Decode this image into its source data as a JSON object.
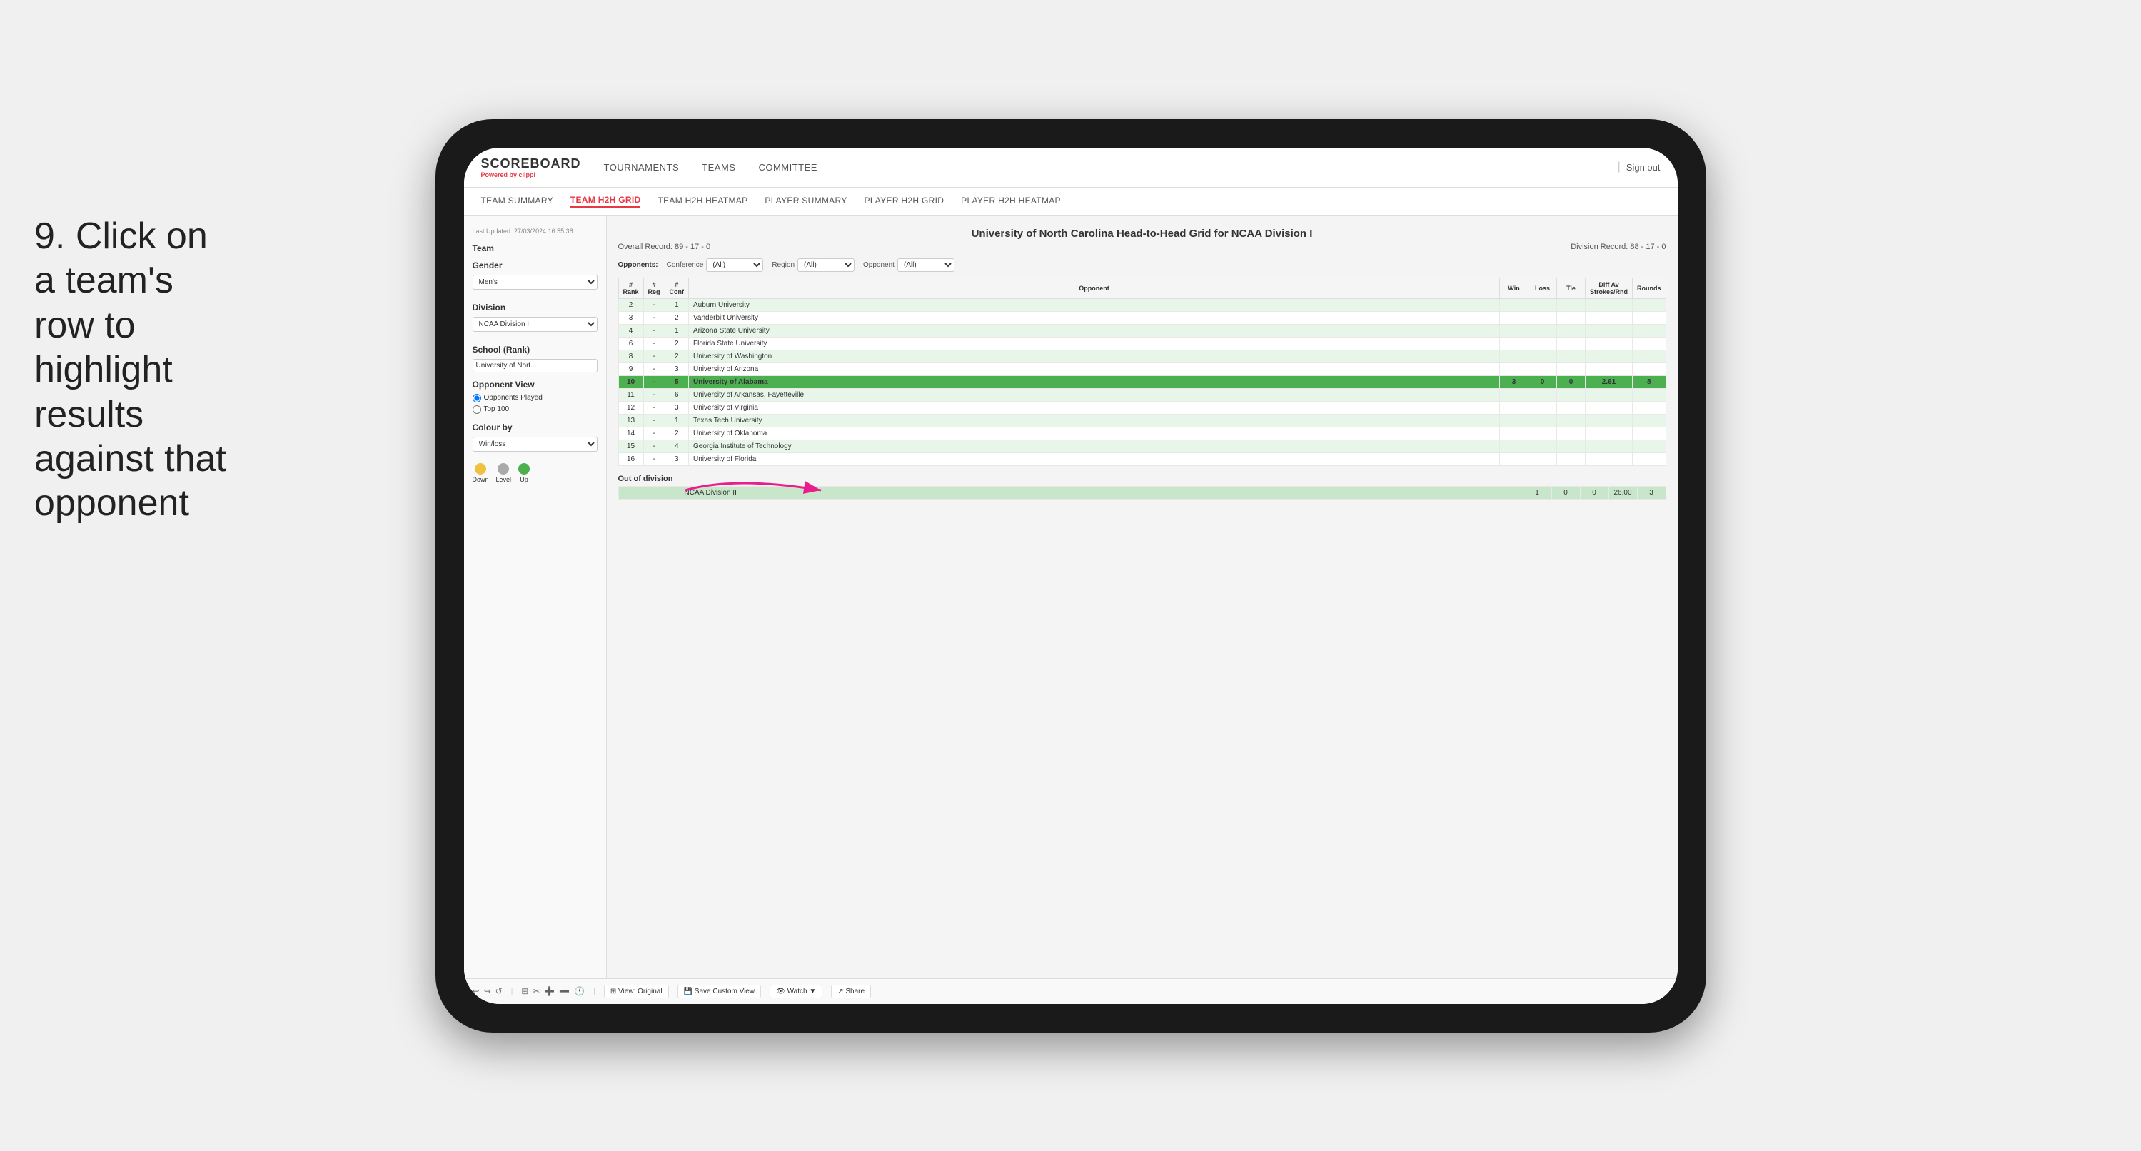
{
  "instruction": {
    "step": "9.",
    "text": "Click on a team's row to highlight results against that opponent"
  },
  "nav": {
    "logo": "SCOREBOARD",
    "powered_by": "Powered by",
    "brand": "clippi",
    "links": [
      "TOURNAMENTS",
      "TEAMS",
      "COMMITTEE"
    ],
    "sign_in": "Sign out"
  },
  "sub_nav": {
    "tabs": [
      {
        "label": "TEAM SUMMARY",
        "active": false
      },
      {
        "label": "TEAM H2H GRID",
        "active": true
      },
      {
        "label": "TEAM H2H HEATMAP",
        "active": false
      },
      {
        "label": "PLAYER SUMMARY",
        "active": false
      },
      {
        "label": "PLAYER H2H GRID",
        "active": false
      },
      {
        "label": "PLAYER H2H HEATMAP",
        "active": false
      }
    ]
  },
  "sidebar": {
    "last_updated": "Last Updated: 27/03/2024 16:55:38",
    "team_label": "Team",
    "gender_label": "Gender",
    "gender_value": "Men's",
    "division_label": "Division",
    "division_value": "NCAA Division I",
    "school_label": "School (Rank)",
    "school_value": "University of Nort...",
    "opponent_view_label": "Opponent View",
    "opponent_options": [
      "Opponents Played",
      "Top 100"
    ],
    "opponent_selected": "Opponents Played",
    "colour_by_label": "Colour by",
    "colour_by_value": "Win/loss",
    "legend": [
      {
        "label": "Down",
        "color": "yellow"
      },
      {
        "label": "Level",
        "color": "gray"
      },
      {
        "label": "Up",
        "color": "green"
      }
    ]
  },
  "grid": {
    "title": "University of North Carolina Head-to-Head Grid for NCAA Division I",
    "overall_record": "Overall Record: 89 - 17 - 0",
    "division_record": "Division Record: 88 - 17 - 0",
    "filters": {
      "opponents_label": "Opponents:",
      "conference_label": "Conference",
      "conference_value": "(All)",
      "region_label": "Region",
      "region_value": "(All)",
      "opponent_label": "Opponent",
      "opponent_value": "(All)"
    },
    "columns": [
      "# Rank",
      "# Reg",
      "# Conf",
      "Opponent",
      "Win",
      "Loss",
      "Tie",
      "Diff Av Strokes/Rnd",
      "Rounds"
    ],
    "rows": [
      {
        "rank": "2",
        "reg": "-",
        "conf": "1",
        "opponent": "Auburn University",
        "win": "",
        "loss": "",
        "tie": "",
        "diff": "",
        "rounds": "",
        "color": "light-green"
      },
      {
        "rank": "3",
        "reg": "-",
        "conf": "2",
        "opponent": "Vanderbilt University",
        "win": "",
        "loss": "",
        "tie": "",
        "diff": "",
        "rounds": "",
        "color": "default"
      },
      {
        "rank": "4",
        "reg": "-",
        "conf": "1",
        "opponent": "Arizona State University",
        "win": "",
        "loss": "",
        "tie": "",
        "diff": "",
        "rounds": "",
        "color": "light-green"
      },
      {
        "rank": "6",
        "reg": "-",
        "conf": "2",
        "opponent": "Florida State University",
        "win": "",
        "loss": "",
        "tie": "",
        "diff": "",
        "rounds": "",
        "color": "default"
      },
      {
        "rank": "8",
        "reg": "-",
        "conf": "2",
        "opponent": "University of Washington",
        "win": "",
        "loss": "",
        "tie": "",
        "diff": "",
        "rounds": "",
        "color": "light-green"
      },
      {
        "rank": "9",
        "reg": "-",
        "conf": "3",
        "opponent": "University of Arizona",
        "win": "",
        "loss": "",
        "tie": "",
        "diff": "",
        "rounds": "",
        "color": "default"
      },
      {
        "rank": "10",
        "reg": "-",
        "conf": "5",
        "opponent": "University of Alabama",
        "win": "3",
        "loss": "0",
        "tie": "0",
        "diff": "2.61",
        "rounds": "8",
        "color": "highlighted"
      },
      {
        "rank": "11",
        "reg": "-",
        "conf": "6",
        "opponent": "University of Arkansas, Fayetteville",
        "win": "",
        "loss": "",
        "tie": "",
        "diff": "",
        "rounds": "",
        "color": "light-green"
      },
      {
        "rank": "12",
        "reg": "-",
        "conf": "3",
        "opponent": "University of Virginia",
        "win": "",
        "loss": "",
        "tie": "",
        "diff": "",
        "rounds": "",
        "color": "default"
      },
      {
        "rank": "13",
        "reg": "-",
        "conf": "1",
        "opponent": "Texas Tech University",
        "win": "",
        "loss": "",
        "tie": "",
        "diff": "",
        "rounds": "",
        "color": "light-green"
      },
      {
        "rank": "14",
        "reg": "-",
        "conf": "2",
        "opponent": "University of Oklahoma",
        "win": "",
        "loss": "",
        "tie": "",
        "diff": "",
        "rounds": "",
        "color": "default"
      },
      {
        "rank": "15",
        "reg": "-",
        "conf": "4",
        "opponent": "Georgia Institute of Technology",
        "win": "",
        "loss": "",
        "tie": "",
        "diff": "",
        "rounds": "",
        "color": "light-green"
      },
      {
        "rank": "16",
        "reg": "-",
        "conf": "3",
        "opponent": "University of Florida",
        "win": "",
        "loss": "",
        "tie": "",
        "diff": "",
        "rounds": "",
        "color": "default"
      }
    ],
    "out_of_division_label": "Out of division",
    "out_of_division_row": {
      "label": "NCAA Division II",
      "win": "1",
      "loss": "0",
      "tie": "0",
      "diff": "26.00",
      "rounds": "3",
      "color": "green"
    }
  },
  "toolbar": {
    "undo_label": "↩",
    "redo_label": "↪",
    "reset_label": "↺",
    "view_label": "⊞ View: Original",
    "save_label": "💾 Save Custom View",
    "watch_label": "👁 Watch ▼",
    "share_label": "↗ Share"
  }
}
